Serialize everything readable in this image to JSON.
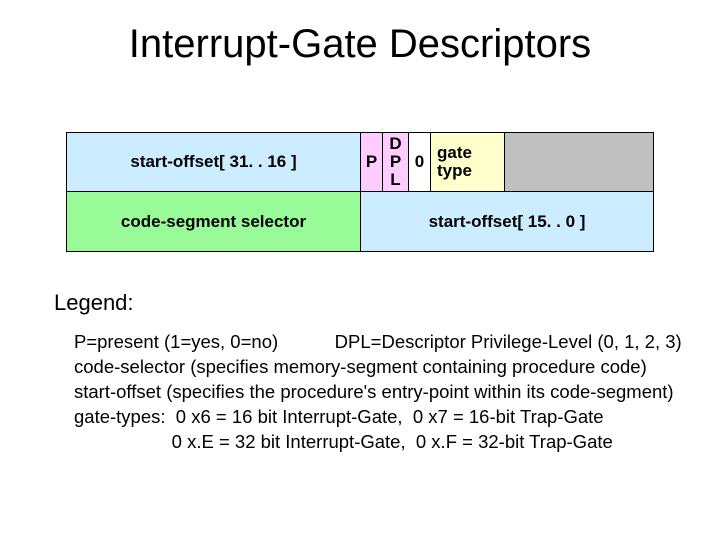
{
  "title": "Interrupt-Gate Descriptors",
  "row1": {
    "offset_hi": "start-offset[ 31. . 16 ]",
    "p": "P",
    "dpl": "D\nP\nL",
    "zero": "0",
    "gate_type": "gate\ntype",
    "reserved": ""
  },
  "row2": {
    "selector": "code-segment selector",
    "offset_lo": "start-offset[ 15. . 0 ]"
  },
  "legend_label": "Legend:",
  "legend_body": "P=present (1=yes, 0=no)           DPL=Descriptor Privilege-Level (0, 1, 2, 3)\ncode-selector (specifies memory-segment containing procedure code)\nstart-offset (specifies the procedure's entry-point within its code-segment)\ngate-types:  0 x6 = 16 bit Interrupt-Gate,  0 x7 = 16-bit Trap-Gate\n                   0 x.E = 32 bit Interrupt-Gate,  0 x.F = 32-bit Trap-Gate"
}
